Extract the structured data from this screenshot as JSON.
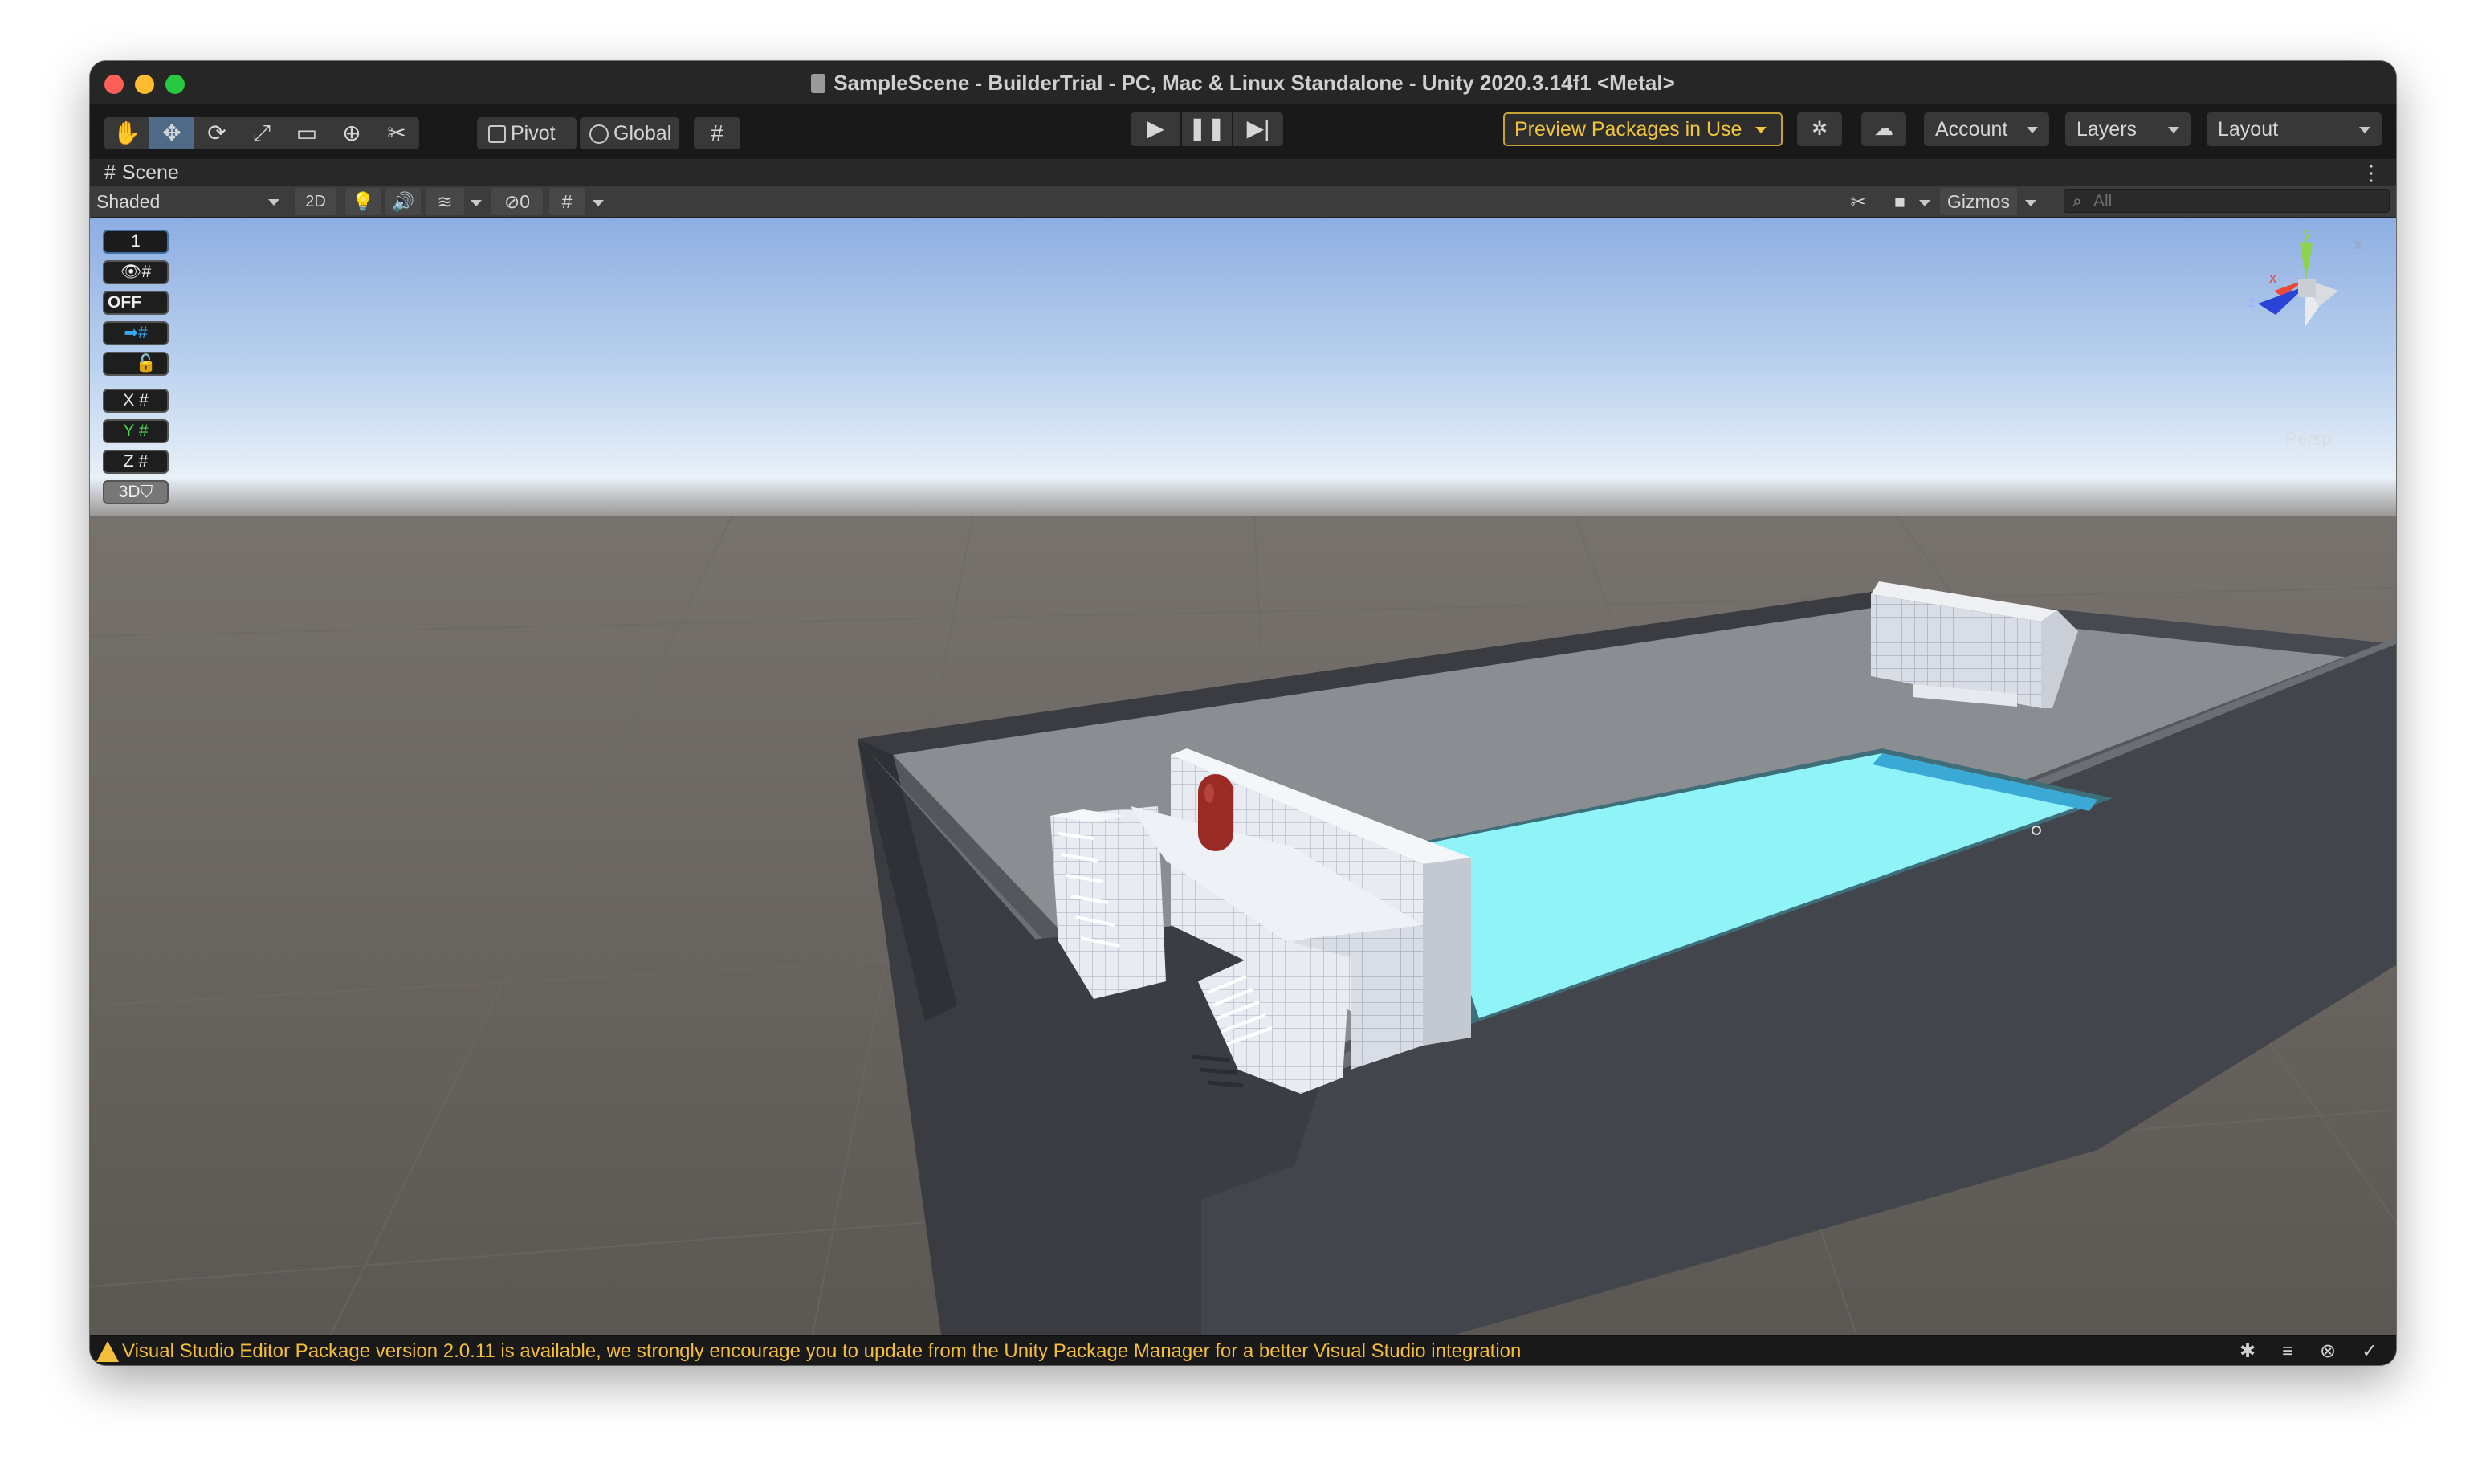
{
  "window": {
    "title": "SampleScene - BuilderTrial - PC, Mac & Linux Standalone - Unity 2020.3.14f1 <Metal>"
  },
  "toolbar": {
    "tools": [
      {
        "name": "hand-tool",
        "glyph": "✋"
      },
      {
        "name": "move-tool",
        "glyph": "✥"
      },
      {
        "name": "rotate-tool",
        "glyph": "⟳"
      },
      {
        "name": "scale-tool",
        "glyph": "⤢"
      },
      {
        "name": "rect-tool",
        "glyph": "▭"
      },
      {
        "name": "transform-tool",
        "glyph": "⊕"
      },
      {
        "name": "custom-tool",
        "glyph": "✂"
      }
    ],
    "pivot_label": "Pivot",
    "global_label": "Global",
    "preview_packages_label": "Preview Packages in Use",
    "account_label": "Account",
    "layers_label": "Layers",
    "layout_label": "Layout"
  },
  "scene_tab": {
    "label": "Scene"
  },
  "scene_toolbar": {
    "shading_mode": "Shaded",
    "mode_2d_label": "2D",
    "hidden_count": "0",
    "gizmos_label": "Gizmos",
    "search_placeholder": "All"
  },
  "overlay": {
    "snap_increment": "1",
    "off_label": "OFF",
    "axis_x": "X",
    "axis_y": "Y",
    "axis_z": "Z",
    "mode_3d": "3D",
    "gizmo_axis_y": "y",
    "gizmo_axis_x": "x",
    "gizmo_axis_z": "z",
    "projection_label": "Persp"
  },
  "statusbar": {
    "warning_text": "Visual Studio Editor Package version 2.0.11 is available, we strongly encourage you to update from the Unity Package Manager for a better Visual Studio integration"
  },
  "colors": {
    "accent_warning": "#f4bd3a",
    "water": "#8ff3f8",
    "ground": "#5e5a56",
    "wall": "#3f4249",
    "sky_top": "#8fb0e4",
    "capsule": "#9a2a24"
  }
}
